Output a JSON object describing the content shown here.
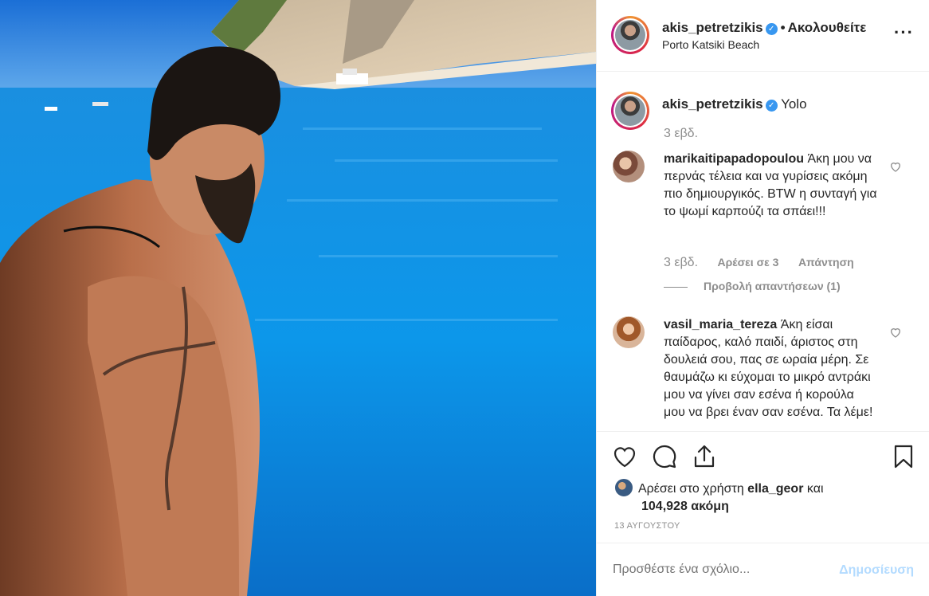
{
  "post": {
    "image_alt": "",
    "author": "akis_petretzikis",
    "follow_status": "Ακολουθείτε",
    "location": "Porto Katsiki Beach",
    "more_icon": "more-options-icon",
    "caption": {
      "user": "akis_petretzikis",
      "text": "Yolo",
      "time": "3 εβδ."
    },
    "comments": [
      {
        "user": "marikaitipapadopoulou",
        "text": "Άκη μου να περνάς τέλεια και να γυρίσεις ακόμη πιο δημιουργικός. BTW η συνταγή για το ψωμί καρπούζι τα σπάει!!!",
        "time": "3 εβδ.",
        "likes": "Αρέσει σε 3",
        "reply": "Απάντηση",
        "view_replies": "Προβολή απαντήσεων (1)"
      },
      {
        "user": "vasil_maria_tereza",
        "text": "Άκη είσαι παίδαρος, καλό παιδί, άριστος στη δουλειά σου, πας σε ωραία μέρη. Σε θαυμάζω κι εύχομαι το μικρό αντράκι μου να γίνει σαν εσένα ή κορούλα μου να βρει έναν σαν εσένα. Τα λέμε!"
      }
    ],
    "likes": {
      "prefix": "Αρέσει στο χρήστη",
      "user": "ella_geor",
      "joiner": "και",
      "count": "104,928 ακόμη"
    },
    "date": "13 ΑΥΓΟΥΣΤΟΥ",
    "add_comment": {
      "placeholder": "Προσθέστε ένα σχόλιο...",
      "post_label": "Δημοσίευση"
    }
  },
  "colors": {
    "verified": "#3897f0",
    "muted": "#8e8e8e",
    "post_disabled": "#b3dbff",
    "text": "#262626"
  }
}
